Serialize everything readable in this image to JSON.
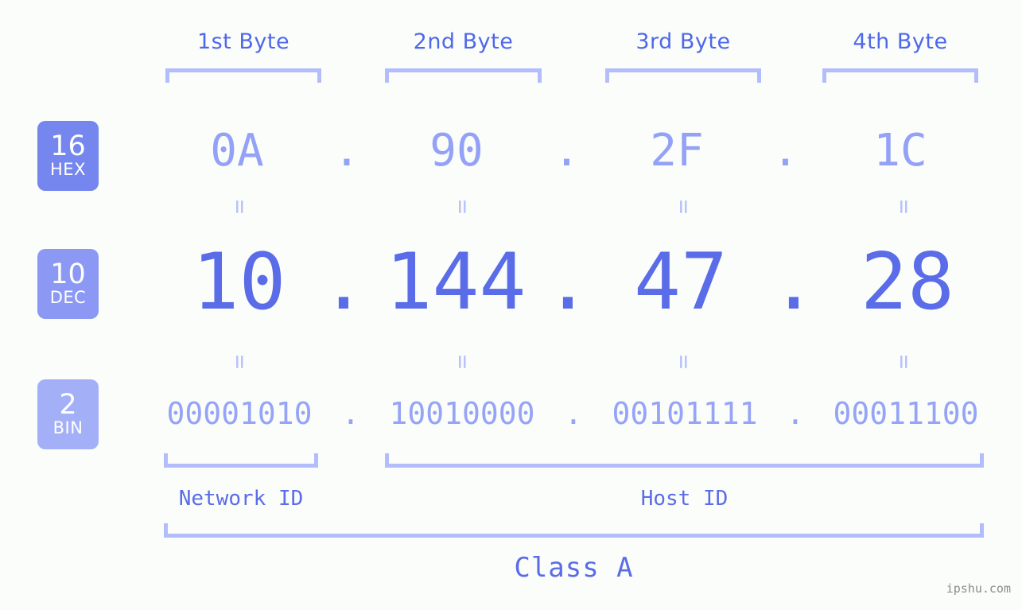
{
  "header": {
    "byte_labels": [
      "1st Byte",
      "2nd Byte",
      "3rd Byte",
      "4th Byte"
    ]
  },
  "rows": {
    "hex": {
      "badge_number": "16",
      "badge_unit": "HEX",
      "values": [
        "0A",
        "90",
        "2F",
        "1C"
      ],
      "separator": "."
    },
    "dec": {
      "badge_number": "10",
      "badge_unit": "DEC",
      "values": [
        "10",
        "144",
        "47",
        "28"
      ],
      "separator": "."
    },
    "bin": {
      "badge_number": "2",
      "badge_unit": "BIN",
      "values": [
        "00001010",
        "10010000",
        "00101111",
        "00011100"
      ],
      "separator": "."
    }
  },
  "equals_marks": {
    "symbol": "=",
    "count_row1": 4,
    "count_row2": 4
  },
  "footer": {
    "network_id_label": "Network ID",
    "host_id_label": "Host ID",
    "class_label": "Class A"
  },
  "watermark": {
    "text": "ipshu.com"
  },
  "colors": {
    "background": "#fbfdfa",
    "bracket": "#b3bdfc",
    "header_text": "#4f68ea",
    "hex_text": "#93a1f6",
    "dec_text": "#5a6ce8",
    "bin_text": "#96a4f7",
    "badge_hex": "#7586ee",
    "badge_dec": "#8b99f4",
    "badge_bin": "#a3b0f8",
    "watermark_text": "#8c8c8c"
  }
}
